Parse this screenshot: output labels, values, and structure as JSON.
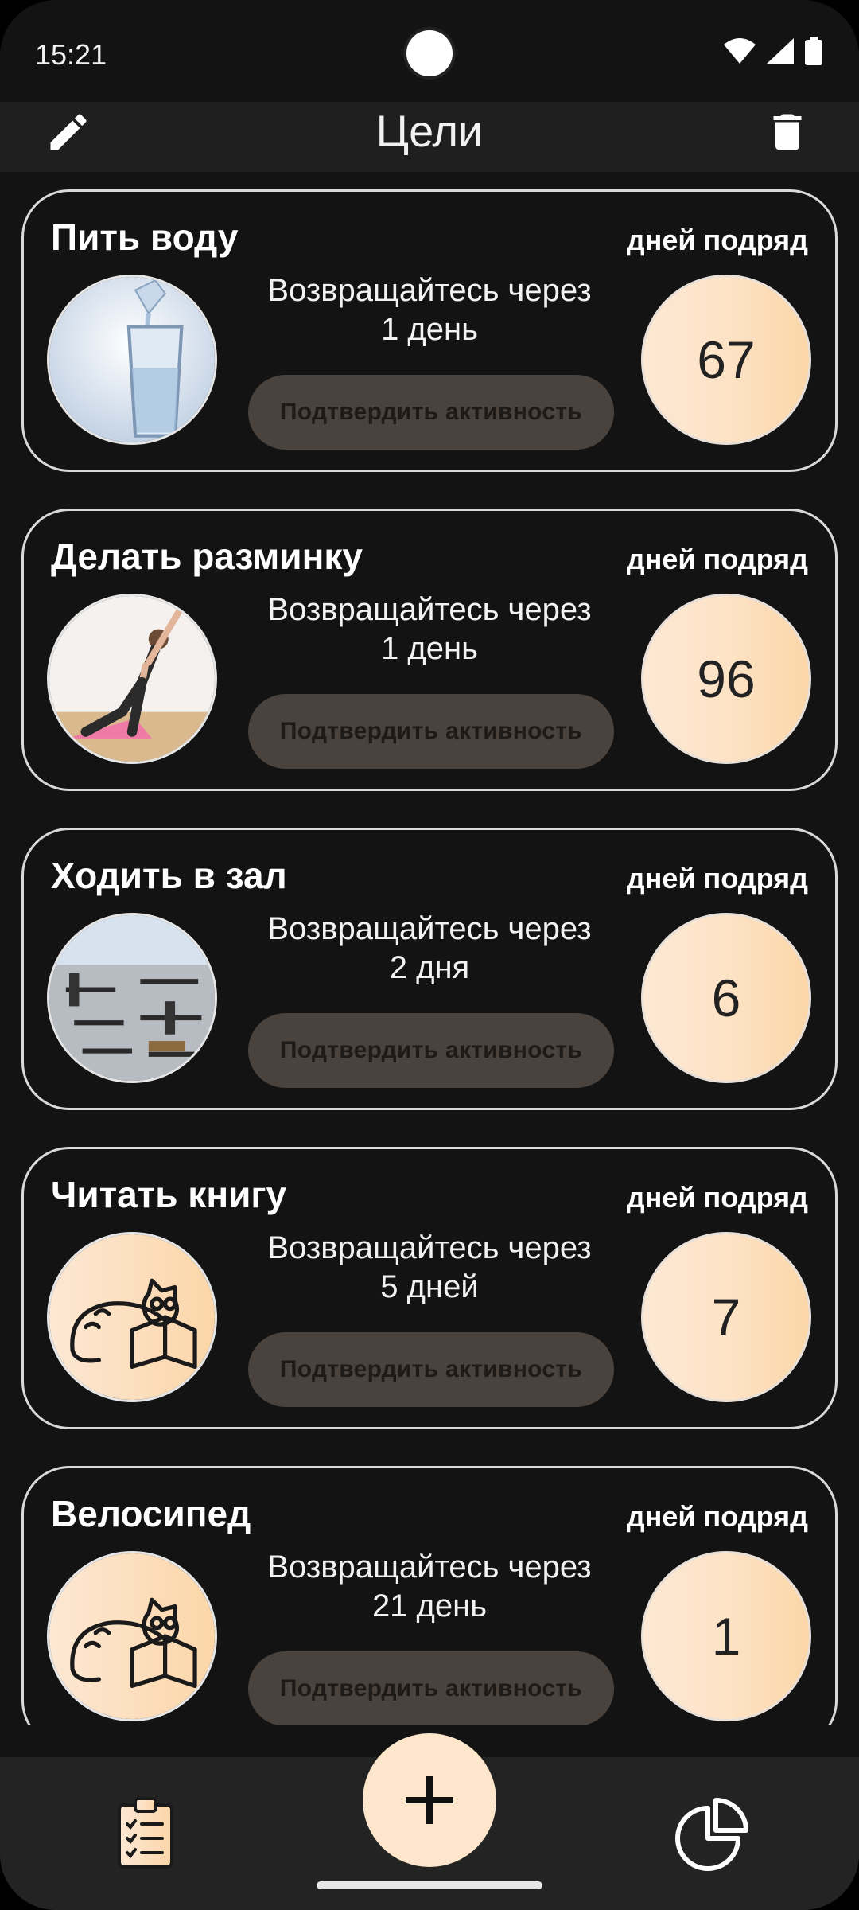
{
  "status_bar": {
    "time": "15:21",
    "icons": [
      "wifi-icon",
      "signal-icon",
      "battery-icon"
    ]
  },
  "top_bar": {
    "title": "Цели",
    "edit_icon": "pencil-icon",
    "delete_icon": "trash-icon"
  },
  "streak_label": "дней подряд",
  "confirm_label": "Подтвердить активность",
  "goals": [
    {
      "title": "Пить воду",
      "return_prefix": "Возвращайтесь через",
      "return_value": "1 день",
      "streak": "67",
      "image": "water-glass-image"
    },
    {
      "title": "Делать разминку",
      "return_prefix": "Возвращайтесь через",
      "return_value": "1 день",
      "streak": "96",
      "image": "workout-image"
    },
    {
      "title": "Ходить в зал",
      "return_prefix": "Возвращайтесь через",
      "return_value": "2 дня",
      "streak": "6",
      "image": "gym-image"
    },
    {
      "title": "Читать книгу",
      "return_prefix": "Возвращайтесь через",
      "return_value": "5 дней",
      "streak": "7",
      "image": "cat-reading-image"
    },
    {
      "title": "Велосипед",
      "return_prefix": "Возвращайтесь через",
      "return_value": "21 день",
      "streak": "1",
      "image": "cat-reading-image"
    }
  ],
  "bottom_nav": {
    "left_icon": "clipboard-checklist-icon",
    "center_icon": "plus-icon",
    "right_icon": "pie-chart-icon"
  },
  "colors": {
    "background": "#131313",
    "accent_peach": "#fde6cb",
    "button_disabled": "#4a423c"
  }
}
